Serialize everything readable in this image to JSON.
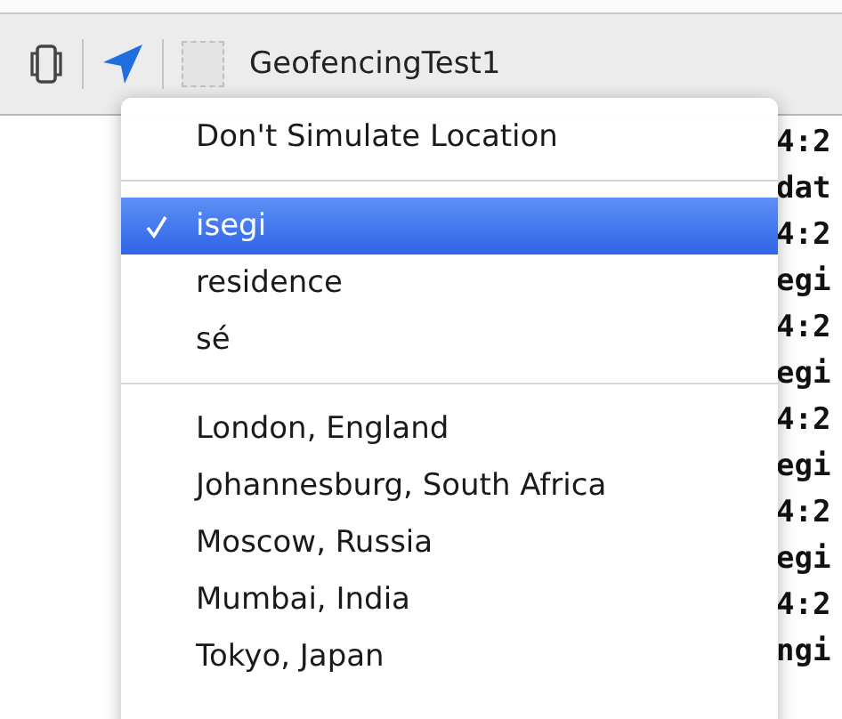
{
  "toolbar": {
    "scheme_name": "GeofencingTest1"
  },
  "console_lines": [
    "4:2",
    "dat",
    "4:2",
    "egi",
    "4:2",
    "egi",
    "4:2",
    "egi",
    "4:2",
    "egi",
    "4:2",
    "ngi"
  ],
  "location_menu": {
    "items": [
      {
        "kind": "item",
        "label": "Don't Simulate Location",
        "selected": false
      },
      {
        "kind": "separator"
      },
      {
        "kind": "item",
        "label": "isegi",
        "selected": true
      },
      {
        "kind": "item",
        "label": "residence",
        "selected": false
      },
      {
        "kind": "item",
        "label": "sé",
        "selected": false
      },
      {
        "kind": "separator"
      },
      {
        "kind": "item",
        "label": "London, England",
        "selected": false
      },
      {
        "kind": "item",
        "label": "Johannesburg, South Africa",
        "selected": false
      },
      {
        "kind": "item",
        "label": "Moscow, Russia",
        "selected": false
      },
      {
        "kind": "item",
        "label": "Mumbai, India",
        "selected": false
      },
      {
        "kind": "item",
        "label": "Tokyo, Japan",
        "selected": false
      }
    ]
  }
}
